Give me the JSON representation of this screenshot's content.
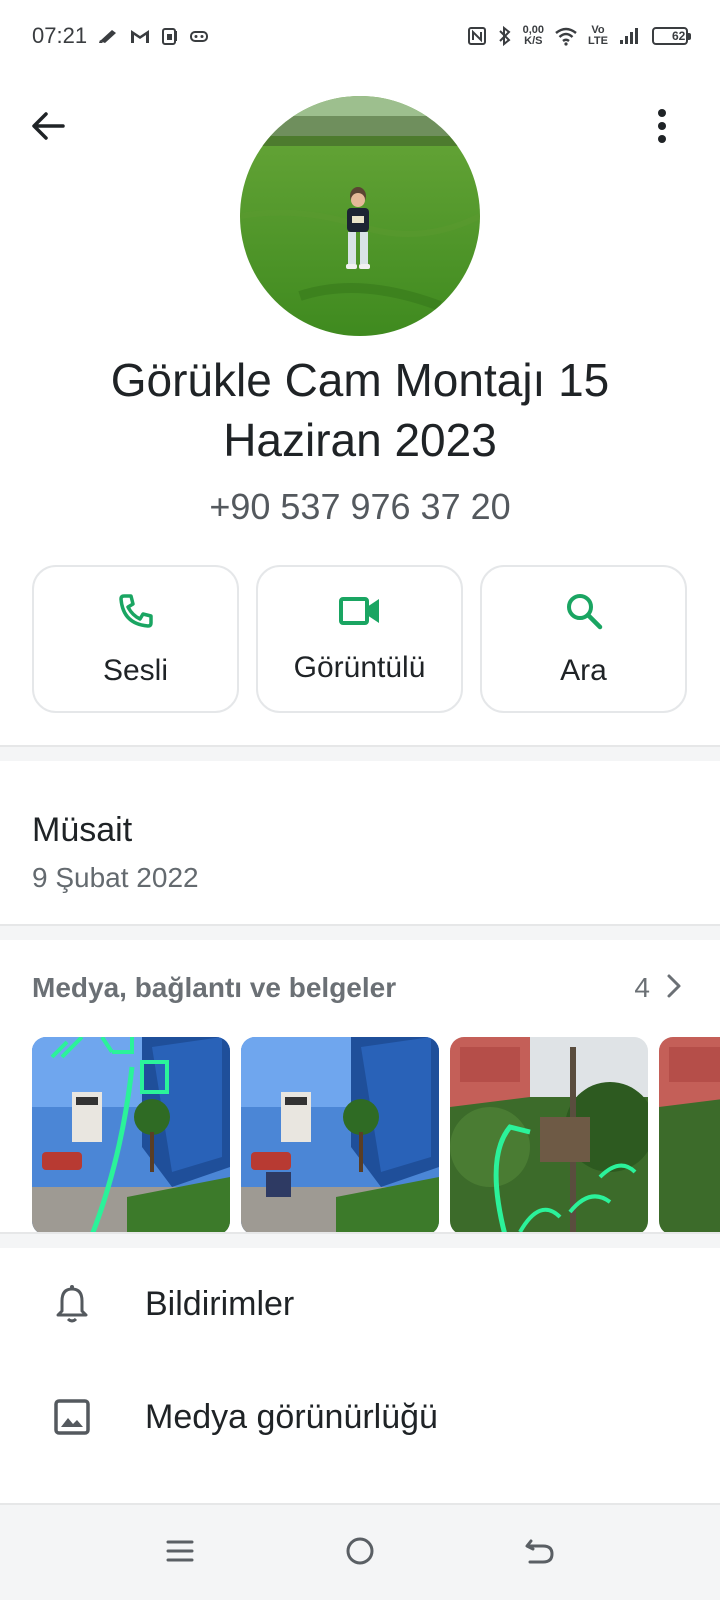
{
  "status_bar": {
    "time": "07:21",
    "net_speed_value": "0,00",
    "net_speed_unit": "K/S",
    "volte_top": "Vo",
    "volte_bottom": "LTE",
    "battery": "62",
    "battery_level": 0.62,
    "icons": [
      "brush-icon",
      "gmail-icon",
      "sim-card-icon",
      "game-controller-icon",
      "nfc-icon",
      "bluetooth-icon",
      "wifi-icon",
      "signal-icon",
      "battery-icon"
    ]
  },
  "app_bar": {
    "back_icon": "arrow-back-icon",
    "more_icon": "more-vert-icon"
  },
  "contact": {
    "name": "Görükle Cam Montajı 15 Haziran 2023",
    "phone": "+90 537 976 37 20"
  },
  "actions": [
    {
      "label": "Sesli",
      "icon": "phone-icon"
    },
    {
      "label": "Görüntülü",
      "icon": "videocam-icon"
    },
    {
      "label": "Ara",
      "icon": "search-icon"
    }
  ],
  "about": {
    "text": "Müsait",
    "date": "9 Şubat 2022"
  },
  "media": {
    "title": "Medya, bağlantı ve belgeler",
    "count": "4"
  },
  "settings": [
    {
      "label": "Bildirimler",
      "icon": "bell-icon"
    },
    {
      "label": "Medya görünürlüğü",
      "icon": "image-icon"
    }
  ],
  "nav": {
    "icons": [
      "menu-icon",
      "home-icon",
      "back-icon"
    ]
  },
  "colors": {
    "accent": "#1aa562",
    "text_primary": "#1f2326",
    "text_secondary": "#646a6f"
  }
}
